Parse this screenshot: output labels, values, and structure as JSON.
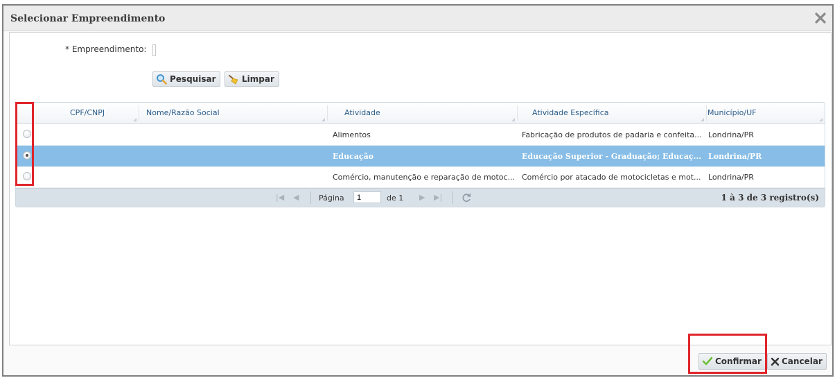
{
  "dialog": {
    "title": "Selecionar Empreendimento",
    "close_icon": "close-icon"
  },
  "form": {
    "label": "* Empreendimento:",
    "value": "",
    "search_label": "Pesquisar",
    "clear_label": "Limpar"
  },
  "grid": {
    "columns": [
      "CPF/CNPJ",
      "Nome/Razão Social",
      "Atividade",
      "Atividade Específica",
      "Município/UF"
    ],
    "rows": [
      {
        "cpf": "",
        "nome": "",
        "atividade": "Alimentos",
        "especifica": "Fabricação de produtos de padaria e confeita...",
        "municipio": "Londrina/PR",
        "selected": false
      },
      {
        "cpf": "",
        "nome": "",
        "atividade": "Educação",
        "especifica": "Educação Superior - Graduação; Educaç...",
        "municipio": "Londrina/PR",
        "selected": true
      },
      {
        "cpf": "",
        "nome": "",
        "atividade": "Comércio, manutenção e reparação de motoc...",
        "especifica": "Comércio por atacado de motocicletas e mot...",
        "municipio": "Londrina/PR",
        "selected": false
      }
    ]
  },
  "pager": {
    "page_label": "Página",
    "page_value": "1",
    "of_label": "de 1",
    "count": "1 à 3 de 3 registro(s)"
  },
  "footer": {
    "confirm_label": "Confirmar",
    "cancel_label": "Cancelar"
  },
  "colors": {
    "selected_row": "#87bde6",
    "highlight_box": "#e0252b",
    "header_text": "#2d5f8b"
  }
}
